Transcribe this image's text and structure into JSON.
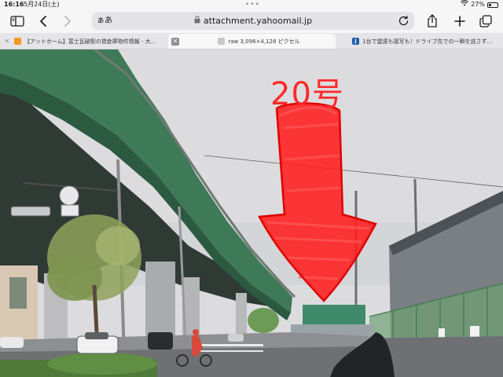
{
  "status_bar": {
    "time": "16:16",
    "date": "5月24日(土)",
    "battery_percent": "27%",
    "battery_level": 0.27
  },
  "toolbar": {
    "aa_label": "ぁあ",
    "url": "attachment.yahoomail.jp",
    "icons": [
      "sidebar-icon",
      "back-icon",
      "forward-icon",
      "lock-icon",
      "reload-icon",
      "share-icon",
      "new-tab-icon",
      "tabs-overview-icon"
    ]
  },
  "tabs": [
    {
      "label": "【アットホーム】富士瓦破駅の貸倉庫物件情報 - 大…",
      "active": false
    },
    {
      "label": "raw 3,096×4,128 ピクセル",
      "active": true
    },
    {
      "label": "1台で望遠も接写も！ドライブ先での一瞬を逃さず…",
      "active": false
    }
  ],
  "photo": {
    "annotation_text": "20号",
    "annotation_color": "#ff2a2a",
    "description_arrow_direction": "down"
  }
}
